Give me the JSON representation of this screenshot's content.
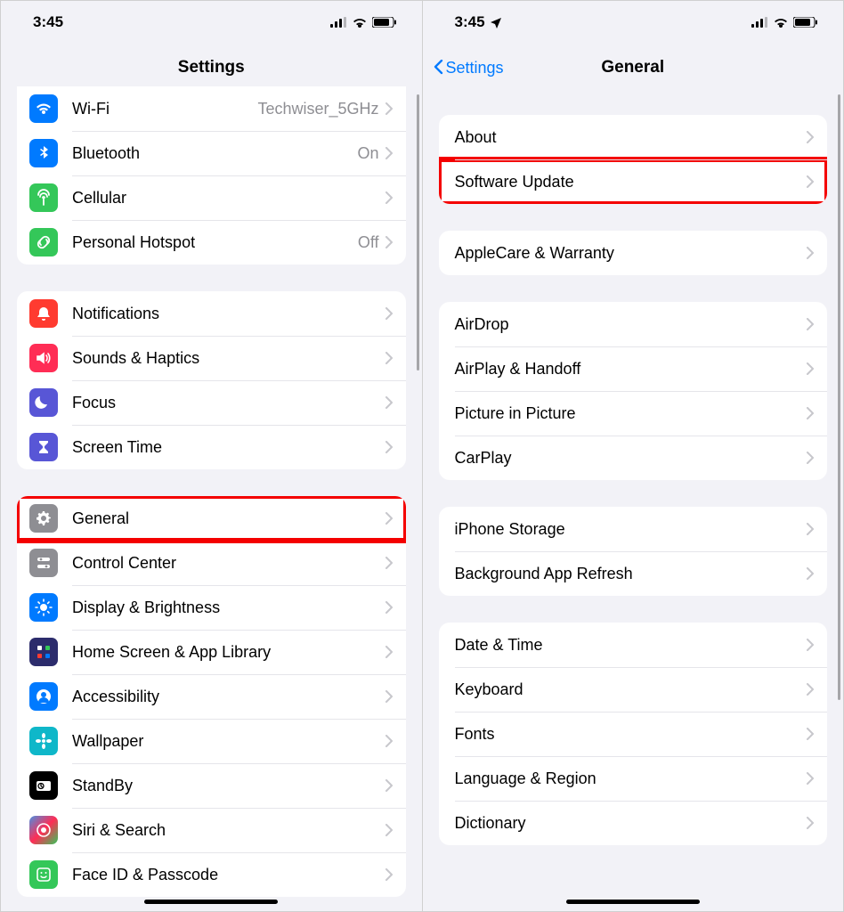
{
  "status": {
    "time": "3:45",
    "location_icon": true
  },
  "left": {
    "title": "Settings",
    "groups": [
      {
        "partialTop": true,
        "rows": [
          {
            "id": "wifi",
            "icon": "ic-wifi",
            "glyph": "wifi",
            "label": "Wi-Fi",
            "value": "Techwiser_5GHz"
          },
          {
            "id": "bluetooth",
            "icon": "ic-bt",
            "glyph": "bt",
            "label": "Bluetooth",
            "value": "On"
          },
          {
            "id": "cellular",
            "icon": "ic-cell",
            "glyph": "cell",
            "label": "Cellular",
            "value": ""
          },
          {
            "id": "hotspot",
            "icon": "ic-hotspot",
            "glyph": "link",
            "label": "Personal Hotspot",
            "value": "Off"
          }
        ]
      },
      {
        "rows": [
          {
            "id": "notifications",
            "icon": "ic-notif",
            "glyph": "bell",
            "label": "Notifications"
          },
          {
            "id": "sounds",
            "icon": "ic-sound",
            "glyph": "speaker",
            "label": "Sounds & Haptics"
          },
          {
            "id": "focus",
            "icon": "ic-focus",
            "glyph": "moon",
            "label": "Focus"
          },
          {
            "id": "screentime",
            "icon": "ic-screen",
            "glyph": "hourglass",
            "label": "Screen Time"
          }
        ]
      },
      {
        "rows": [
          {
            "id": "general",
            "icon": "ic-general",
            "glyph": "gear",
            "label": "General",
            "highlight": true
          },
          {
            "id": "controlcenter",
            "icon": "ic-cc",
            "glyph": "sliders",
            "label": "Control Center"
          },
          {
            "id": "display",
            "icon": "ic-display",
            "glyph": "sun",
            "label": "Display & Brightness"
          },
          {
            "id": "homescreen",
            "icon": "ic-home",
            "glyph": "grid",
            "label": "Home Screen & App Library"
          },
          {
            "id": "accessibility",
            "icon": "ic-access",
            "glyph": "person",
            "label": "Accessibility"
          },
          {
            "id": "wallpaper",
            "icon": "ic-wall",
            "glyph": "flower",
            "label": "Wallpaper"
          },
          {
            "id": "standby",
            "icon": "ic-standby",
            "glyph": "clock",
            "label": "StandBy"
          },
          {
            "id": "siri",
            "icon": "ic-siri",
            "glyph": "siri",
            "label": "Siri & Search"
          },
          {
            "id": "faceid",
            "icon": "ic-face",
            "glyph": "face",
            "label": "Face ID & Passcode"
          }
        ]
      }
    ]
  },
  "right": {
    "title": "General",
    "back": "Settings",
    "groups": [
      {
        "rows": [
          {
            "id": "about",
            "label": "About"
          },
          {
            "id": "software-update",
            "label": "Software Update",
            "highlight": true
          }
        ]
      },
      {
        "rows": [
          {
            "id": "applecare",
            "label": "AppleCare & Warranty"
          }
        ]
      },
      {
        "rows": [
          {
            "id": "airdrop",
            "label": "AirDrop"
          },
          {
            "id": "airplay",
            "label": "AirPlay & Handoff"
          },
          {
            "id": "pip",
            "label": "Picture in Picture"
          },
          {
            "id": "carplay",
            "label": "CarPlay"
          }
        ]
      },
      {
        "rows": [
          {
            "id": "storage",
            "label": "iPhone Storage"
          },
          {
            "id": "bgrefresh",
            "label": "Background App Refresh"
          }
        ]
      },
      {
        "rows": [
          {
            "id": "datetime",
            "label": "Date & Time"
          },
          {
            "id": "keyboard",
            "label": "Keyboard"
          },
          {
            "id": "fonts",
            "label": "Fonts"
          },
          {
            "id": "language",
            "label": "Language & Region"
          },
          {
            "id": "dictionary",
            "label": "Dictionary"
          }
        ]
      }
    ]
  }
}
